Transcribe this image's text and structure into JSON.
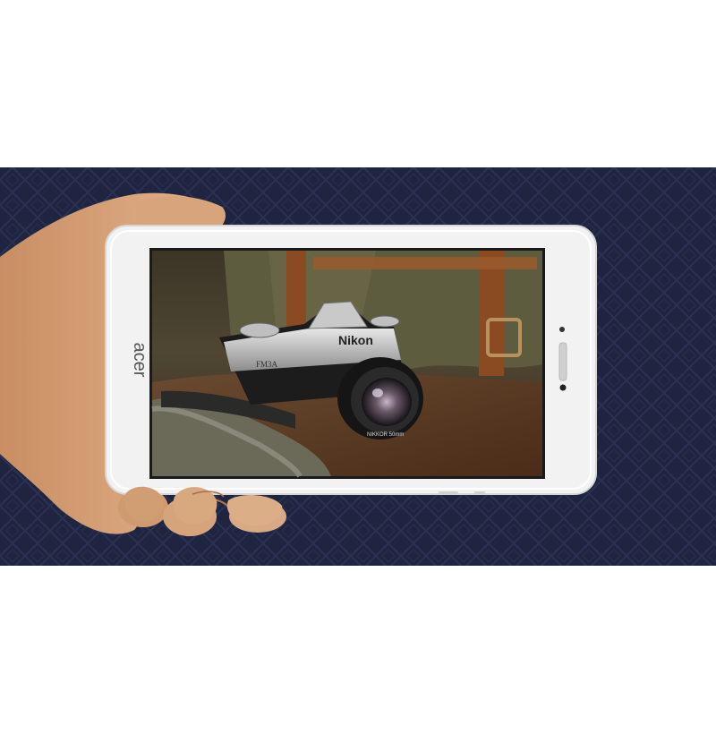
{
  "image": {
    "subject": "hand holding tablet displaying camera photo",
    "tablet_brand_text": "acer",
    "camera_brand_text": "Nikon",
    "camera_model_text": "FM3A",
    "lens_text": "NIKKOR 50mm"
  },
  "colors": {
    "page_background": "#ffffff",
    "backdrop_navy": "#1f2540",
    "tablet_body": "#f2f2f2",
    "skin": "#d9a57d",
    "leather_strap": "#8a4a22",
    "bag_olive": "#5d5c3e",
    "table_brown": "#5a3a24"
  },
  "icons": [
    "front-camera-icon",
    "light-sensor-icon"
  ]
}
